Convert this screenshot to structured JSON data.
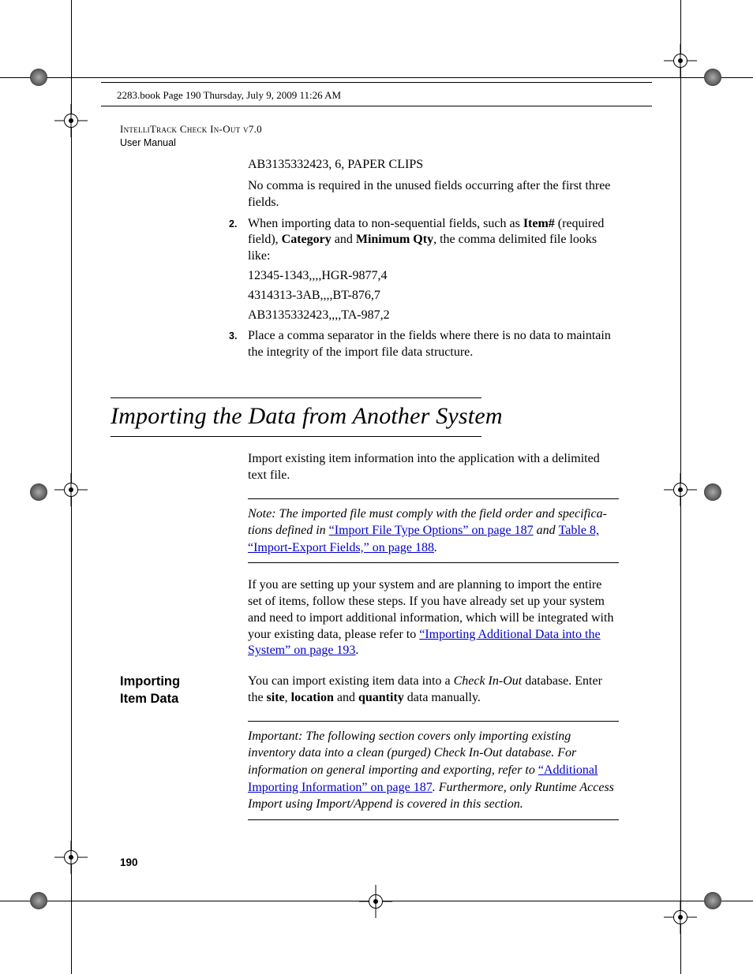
{
  "meta": {
    "book_line": "2283.book  Page 190  Thursday, July 9, 2009  11:26 AM"
  },
  "running_head": {
    "line1": "IntelliTrack Check In-Out v7.0",
    "line2": "User Manual"
  },
  "top": {
    "p1": "AB3135332423, 6, PAPER CLIPS",
    "p2": "No comma is required in the unused fields occurring after the first three fields."
  },
  "ol2": {
    "num": "2.",
    "lead_a": "When importing data to non-sequential fields, such as ",
    "bold_item": "Item#",
    "lead_b": " (required field), ",
    "bold_cat": "Category",
    "lead_c": " and ",
    "bold_min": "Minimum Qty",
    "lead_d": ", the comma delimited file looks like:",
    "l1": "12345-1343,,,,HGR-9877,4",
    "l2": "4314313-3AB,,,,BT-876,7",
    "l3": "AB3135332423,,,,TA-987,2"
  },
  "ol3": {
    "num": "3.",
    "text": "Place a comma separator in the fields where there is no data to maintain the integrity of the import file data structure."
  },
  "section": {
    "title": "Importing the Data from Another System",
    "intro": "Import existing item information into the application with a delimited text file."
  },
  "note1": {
    "label": "Note:   ",
    "t1": "The imported file must comply with the field order and specifica­tions defined in ",
    "link1": "“Import File Type Options” on page 187",
    "t2": " and ",
    "link2": "Table 8, “Import-Export Fields,” on page 188",
    "t3": "."
  },
  "para_setup": {
    "t1": "If you are setting up your system and are planning to import the entire set of items, follow these steps. If you have already set up your system and need to import additional information, which will be integrated with your existing data, please refer to ",
    "link": "“Importing Additional Data into the System” on page 193",
    "t2": "."
  },
  "side1": {
    "head_l1": "Importing",
    "head_l2": "Item Data",
    "body_a": "You can import existing item data into a ",
    "ital": "Check In-Out",
    "body_b": " database. Enter the ",
    "b_site": "site",
    "body_c": ", ",
    "b_loc": "location",
    "body_d": " and ",
    "b_qty": "quantity",
    "body_e": " data manually."
  },
  "note2": {
    "label": "Important:   ",
    "t1": "The following section covers only importing existing inventory data into a clean (purged) Check In-Out database. For information on general importing and exporting, refer to ",
    "link": "“Additional Importing Information” on page 187",
    "t2": ". Furthermore, only Runtime Access Import using Import/Append is covered in this section."
  },
  "page_number": "190"
}
